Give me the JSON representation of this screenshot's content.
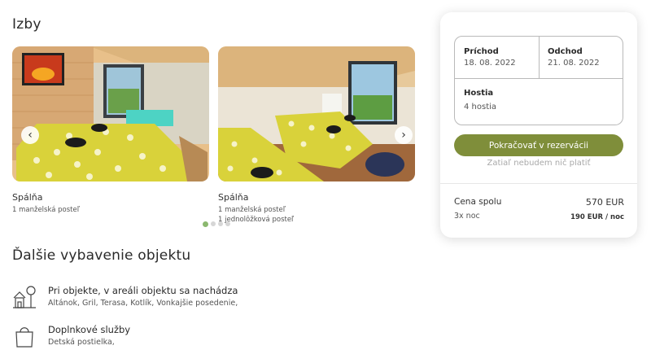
{
  "rooms": {
    "title": "Izby",
    "items": [
      {
        "name": "Spálňa",
        "beds": [
          "1  manželská  posteľ"
        ]
      },
      {
        "name": "Spálňa",
        "beds": [
          "1  manželská  posteľ",
          "1  jednolôžková  posteľ"
        ]
      }
    ],
    "carousel": {
      "prev_icon": "chevron-left-icon",
      "next_icon": "chevron-right-icon",
      "dot_count": 4,
      "active_dot": 0
    }
  },
  "amenities": {
    "title": "Ďalšie vybavenie objektu",
    "items": [
      {
        "icon": "house-tree-icon",
        "title": "Pri objekte, v areáli objektu sa nachádza",
        "desc": "Altánok, Gril, Terasa, Kotlík, Vonkajšie posedenie,"
      },
      {
        "icon": "shopping-bag-icon",
        "title": "Doplnkové služby",
        "desc": "Detská postielka,"
      }
    ]
  },
  "booking": {
    "arrival_label": "Príchod",
    "arrival_value": "18. 08. 2022",
    "departure_label": "Odchod",
    "departure_value": "21. 08. 2022",
    "guests_label": "Hostia",
    "guests_value": "4 hostia",
    "continue_label": "Pokračovať v rezervácii",
    "no_charge_note": "Zatiaľ nebudem nič platiť",
    "total_label": "Cena spolu",
    "total_value": "570 EUR",
    "nights_label": "3x noc",
    "per_night": "190 EUR / noc",
    "accent_color": "#7f8e3a"
  }
}
